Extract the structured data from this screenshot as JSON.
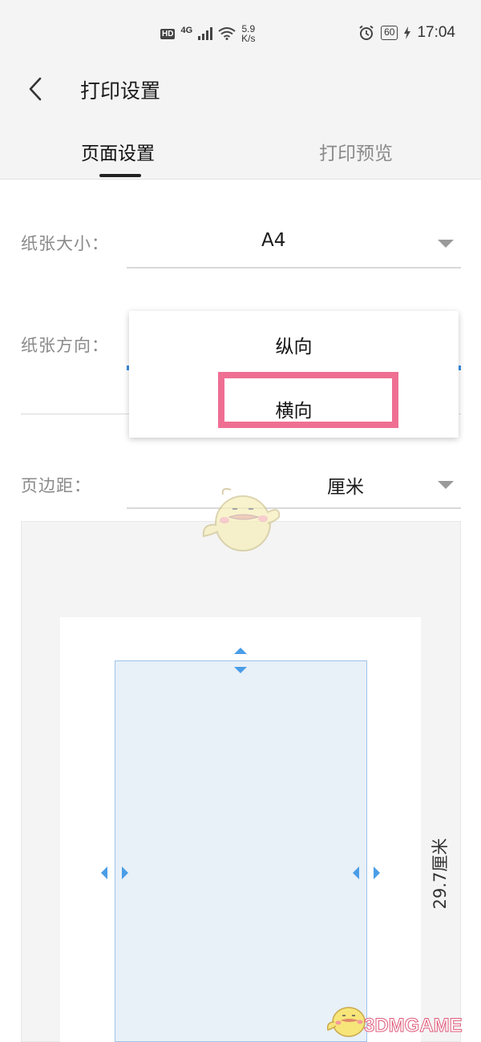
{
  "status_bar": {
    "badge_hd": "HD",
    "network": "4G",
    "speed_value": "5.9",
    "speed_unit": "K/s",
    "battery": "60",
    "time": "17:04"
  },
  "header": {
    "title": "打印设置",
    "tabs": [
      {
        "label": "页面设置",
        "active": true
      },
      {
        "label": "打印预览",
        "active": false
      }
    ]
  },
  "form": {
    "paper_size": {
      "label": "纸张大小：",
      "value": "A4"
    },
    "orientation": {
      "label": "纸张方向：",
      "options": [
        "纵向",
        "横向"
      ],
      "highlighted": "横向"
    },
    "margin": {
      "label": "页边距：",
      "unit": "厘米"
    }
  },
  "preview": {
    "height_label": "29.7厘米"
  },
  "watermark": {
    "text": "3DMGAME"
  },
  "colors": {
    "accent_blue": "#4a9de6",
    "highlight_pink": "#ef6f93",
    "margin_fill": "#e8f0f8"
  }
}
